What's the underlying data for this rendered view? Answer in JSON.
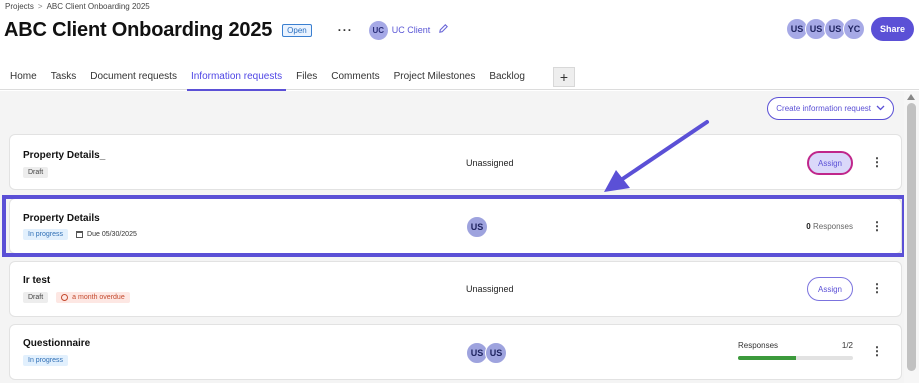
{
  "breadcrumb": {
    "root": "Projects",
    "separator": ">",
    "current": "ABC Client Onboarding 2025"
  },
  "header": {
    "title": "ABC Client Onboarding 2025",
    "status": "Open",
    "more": "···",
    "client": {
      "initials": "UC",
      "name": "UC Client"
    },
    "members": [
      "US",
      "US",
      "US",
      "YC"
    ],
    "share_label": "Share"
  },
  "tabs": [
    "Home",
    "Tasks",
    "Document requests",
    "Information requests",
    "Files",
    "Comments",
    "Project Milestones",
    "Backlog"
  ],
  "active_tab": "Information requests",
  "tab_add": "+",
  "toolbar": {
    "create_label": "Create information request"
  },
  "requests": [
    {
      "name": "Property Details_",
      "status": "Draft",
      "assignee_text": "Unassigned",
      "action": "Assign"
    },
    {
      "name": "Property Details",
      "status": "In progress",
      "due": "Due 05/30/2025",
      "assignees": [
        "US"
      ],
      "responses_count": "0",
      "responses_label": "Responses"
    },
    {
      "name": "Ir test",
      "status": "Draft",
      "overdue": "a month overdue",
      "assignee_text": "Unassigned",
      "action": "Assign"
    },
    {
      "name": "Questionnaire",
      "status": "In progress",
      "assignees": [
        "US",
        "US"
      ],
      "responses_label": "Responses",
      "responses_ratio": "1/2",
      "progress": 0.5
    }
  ],
  "colors": {
    "accent": "#5b50d6",
    "progress_fill": "#3c9a3c",
    "highlight": "#5b50d6"
  }
}
